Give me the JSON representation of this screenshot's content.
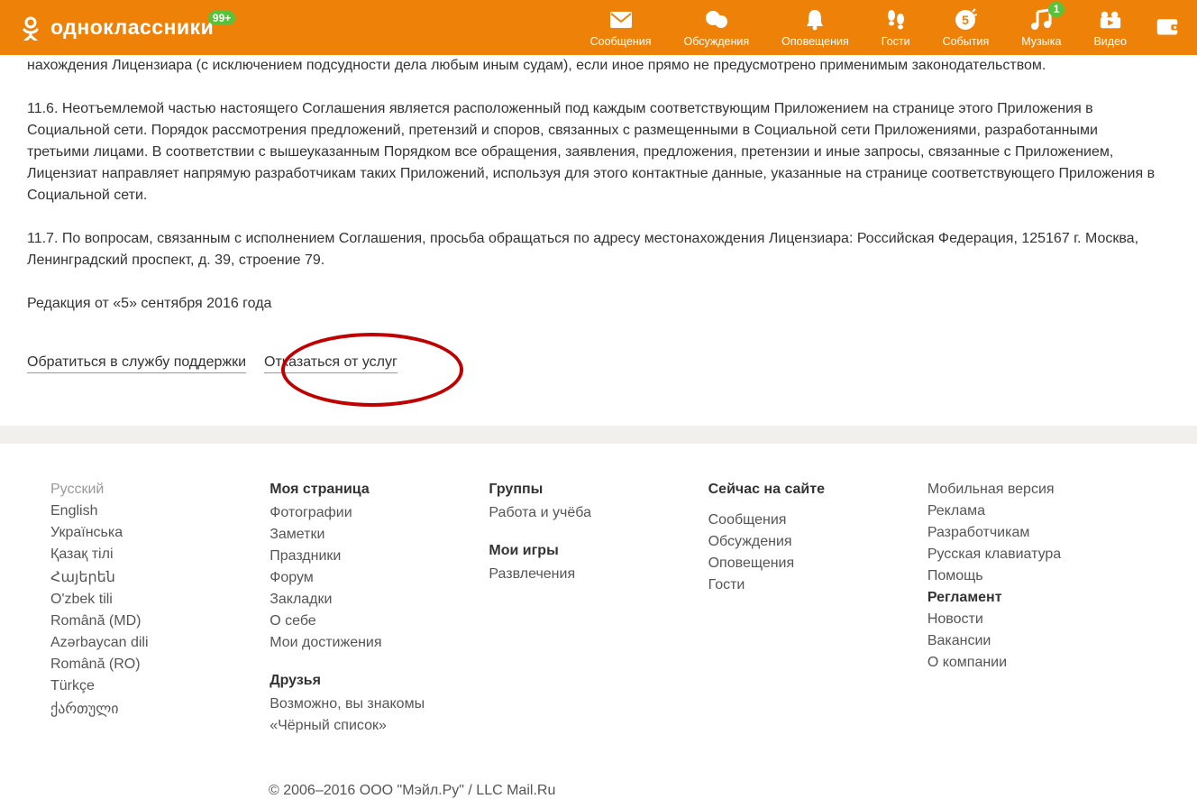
{
  "header": {
    "logo_text": "одноклассники",
    "logo_badge": "99+",
    "nav": [
      {
        "label": "Сообщения",
        "icon": "mail"
      },
      {
        "label": "Обсуждения",
        "icon": "chat"
      },
      {
        "label": "Оповещения",
        "icon": "bell"
      },
      {
        "label": "Гости",
        "icon": "footprints"
      },
      {
        "label": "События",
        "icon": "coin"
      },
      {
        "label": "Музыка",
        "icon": "music",
        "badge": "1"
      },
      {
        "label": "Видео",
        "icon": "video"
      }
    ]
  },
  "content": {
    "p1": "нахождения Лицензиара (с исключением подсудности дела любым иным судам), если иное прямо не предусмотрено применимым законодательством.",
    "p2": "11.6. Неотъемлемой частью настоящего Соглашения является расположенный под каждым соответствующим Приложением на странице этого Приложения в Социальной сети. Порядок рассмотрения предложений, претензий и споров, связанных с размещенными в Социальной сети Приложениями, разработанными третьими лицами. В соответствии с вышеуказанным Порядком все обращения, заявления, предложения, претензии и иные запросы, связанные с Приложением, Лицензиат направляет напрямую разработчикам таких Приложений, используя для этого контактные данные, указанные на странице соответствующего Приложения в Социальной сети.",
    "p3": "11.7. По вопросам, связанным с исполнением Соглашения, просьба обращаться по адресу местонахождения Лицензиара: Российская Федерация, 125167 г. Москва, Ленинградский проспект, д. 39, строение 79.",
    "p4": "Редакция от «5» сентября 2016 года",
    "link_support": "Обратиться в службу поддержки",
    "link_decline": "Отказаться от услуг"
  },
  "footer": {
    "col1": {
      "items": [
        "Русский",
        "English",
        "Українська",
        "Қазақ тілі",
        "Հայերեն",
        "O'zbek tili",
        "Română (MD)",
        "Azərbaycan dili",
        "Română (RO)",
        "Türkçe",
        "ქართული"
      ]
    },
    "col2": {
      "title": "Моя страница",
      "items": [
        "Фотографии",
        "Заметки",
        "Праздники",
        "Форум",
        "Закладки",
        "О себе",
        "Мои достижения"
      ],
      "subtitle": "Друзья",
      "subitems": [
        "Возможно, вы знакомы",
        "«Чёрный список»"
      ]
    },
    "col3": {
      "title": "Группы",
      "items": [
        "Работа и учёба"
      ],
      "subtitle": "Мои игры",
      "subitems": [
        "Развлечения"
      ]
    },
    "col4": {
      "title": "Сейчас на сайте",
      "items": [
        "Сообщения",
        "Обсуждения",
        "Оповещения",
        "Гости"
      ]
    },
    "col5": {
      "items": [
        "Мобильная версия",
        "Реклама",
        "Разработчикам",
        "Русская клавиатура",
        "Помощь",
        "Регламент",
        "Новости",
        "Вакансии",
        "О компании"
      ]
    },
    "copyright": "© 2006–2016 ООО \"Мэйл.Ру\" / LLC Mail.Ru"
  }
}
